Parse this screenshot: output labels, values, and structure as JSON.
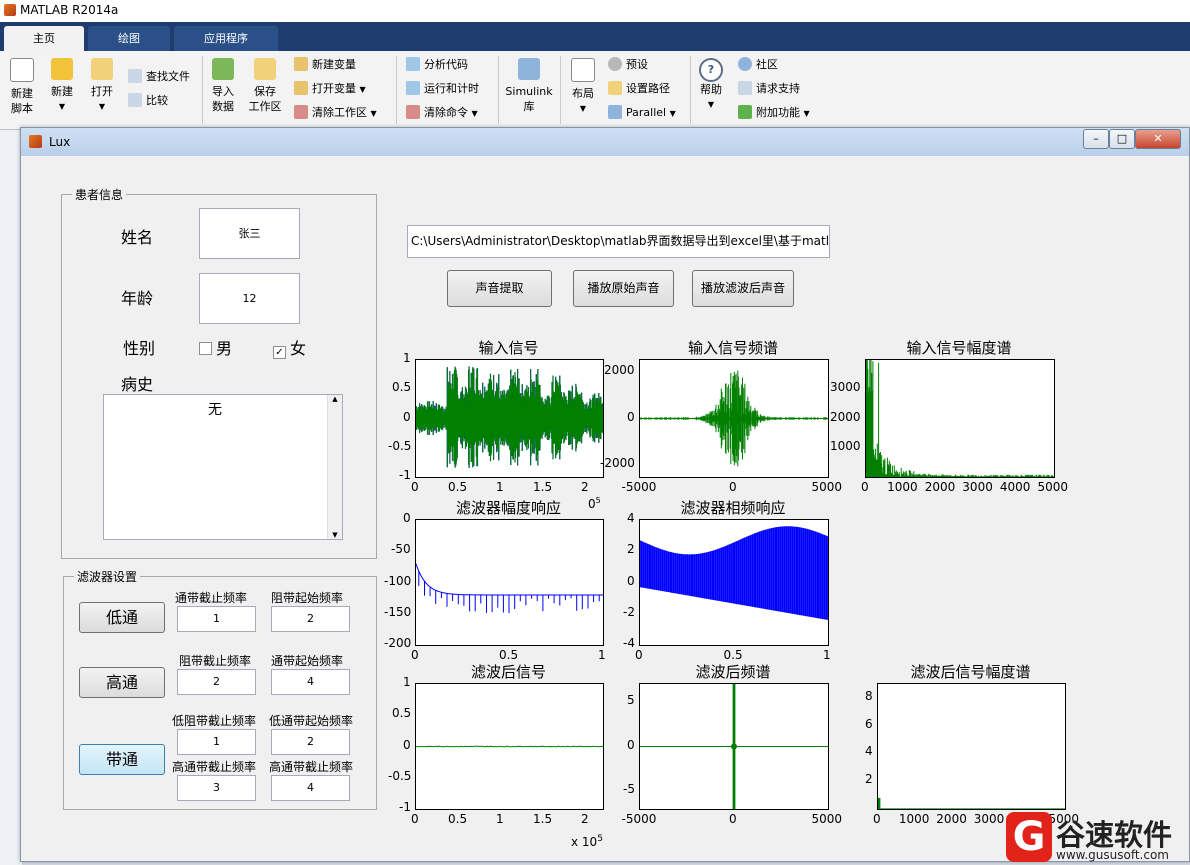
{
  "matlab": {
    "title": "MATLAB R2014a",
    "tabs": [
      "主页",
      "绘图",
      "应用程序"
    ],
    "toolbar": {
      "new_script": "新建\n脚本",
      "new": "新建",
      "open": "打开",
      "find_files": "查找文件",
      "compare": "比较",
      "import_data": "导入\n数据",
      "save_workspace": "保存\n工作区",
      "new_variable": "新建变量",
      "open_variable": "打开变量",
      "clear_workspace": "清除工作区",
      "analyze_code": "分析代码",
      "run_and_time": "运行和计时",
      "clear_commands": "清除命令",
      "simulink_library": "Simulink\n库",
      "layout": "布局",
      "preferences": "预设",
      "set_path": "设置路径",
      "parallel": "Parallel",
      "help": "帮助",
      "community": "社区",
      "request_support": "请求支持",
      "add_ons": "附加功能"
    }
  },
  "lux": {
    "title": "Lux",
    "patient_panel": {
      "title": "患者信息",
      "name_label": "姓名",
      "name_value": "张三",
      "age_label": "年龄",
      "age_value": "12",
      "gender_label": "性别",
      "male": "男",
      "female": "女",
      "male_checked": false,
      "female_checked": true,
      "history_label": "病史",
      "history_value": "无"
    },
    "filter_panel": {
      "title": "滤波器设置",
      "lowpass_button": "低通",
      "highpass_button": "高通",
      "bandpass_button": "带通",
      "lp_pass_label": "通带截止频率",
      "lp_pass_value": "1",
      "lp_stop_label": "阻带起始频率",
      "lp_stop_value": "2",
      "hp_stop_label": "阻带截止频率",
      "hp_stop_value": "2",
      "hp_pass_label": "通带起始频率",
      "hp_pass_value": "4",
      "bp_low_stop_label": "低阻带截止频率",
      "bp_low_stop_value": "1",
      "bp_low_pass_label": "低通带起始频率",
      "bp_low_pass_value": "2",
      "bp_high_pass_label": "高通带截止频率",
      "bp_high_pass_value": "3",
      "bp_high_stop_label": "高通带截止频率",
      "bp_high_stop_value": "4"
    },
    "file_path": "C:\\Users\\Administrator\\Desktop\\matlab界面数据导出到excel里\\基于matl",
    "extract_button": "声音提取",
    "play_original_button": "播放原始声音",
    "play_filtered_button": "播放滤波后声音"
  },
  "watermark": {
    "brand": "谷速软件",
    "url": "www.gususoft.com"
  },
  "colors": {
    "signal_blue": "#0000ff",
    "signal_green": "#007f00"
  },
  "chart_data": [
    {
      "id": "input-signal",
      "type": "line",
      "title": "输入信号",
      "xlim": [
        0,
        220000
      ],
      "ylim": [
        -1,
        1
      ],
      "xticks": [
        "0",
        "0.5",
        "1",
        "1.5",
        "2"
      ],
      "yticks": [
        "1",
        "0.5",
        "0",
        "-0.5",
        "-1"
      ],
      "x_exponent": "5",
      "series": [
        {
          "color": "#007f00",
          "envelope": [
            0.28,
            0.3,
            0.25,
            0.9,
            0.55,
            0.95,
            0.7,
            0.8,
            0.5,
            0.85,
            0.6,
            0.9,
            0.4,
            0.75,
            0.5,
            0.6,
            0.35,
            0.45
          ]
        }
      ]
    },
    {
      "id": "input-spectrum",
      "type": "line",
      "title": "输入信号频谱",
      "xlim": [
        -5000,
        5000
      ],
      "ylim": [
        -2500,
        2500
      ],
      "xticks": [
        "-5000",
        "0",
        "5000"
      ],
      "yticks": [
        "2000",
        "0",
        "-2000"
      ],
      "series": [
        {
          "color": "#007f00",
          "peak": 2300
        }
      ]
    },
    {
      "id": "input-amplitude-spectrum",
      "type": "line",
      "title": "输入信号幅度谱",
      "xlim": [
        0,
        5000
      ],
      "ylim": [
        0,
        4000
      ],
      "xticks": [
        "0",
        "1000",
        "2000",
        "3000",
        "4000",
        "5000"
      ],
      "yticks": [
        "3000",
        "2000",
        "1000"
      ],
      "series": [
        {
          "color": "#007f00",
          "peak": 3900
        }
      ]
    },
    {
      "id": "filter-magnitude",
      "type": "line",
      "title": "滤波器幅度响应",
      "xlim": [
        0,
        1
      ],
      "ylim": [
        -200,
        0
      ],
      "xticks": [
        "0",
        "0.5",
        "1"
      ],
      "yticks": [
        "0",
        "-50",
        "-100",
        "-150",
        "-200"
      ],
      "series": [
        {
          "color": "#0000ff",
          "start": -70,
          "floor": -120
        }
      ]
    },
    {
      "id": "filter-phase",
      "type": "line",
      "title": "滤波器相频响应",
      "xlim": [
        0,
        1
      ],
      "ylim": [
        -4,
        4
      ],
      "xticks": [
        "0",
        "0.5",
        "1"
      ],
      "yticks": [
        "4",
        "2",
        "0",
        "-2",
        "-4"
      ],
      "series": [
        {
          "color": "#0000ff",
          "amplitude": 3
        }
      ]
    },
    {
      "id": "filtered-signal",
      "type": "line",
      "title": "滤波后信号",
      "xlim": [
        0,
        220000
      ],
      "ylim": [
        -1,
        1
      ],
      "xticks": [
        "0",
        "0.5",
        "1",
        "1.5",
        "2"
      ],
      "yticks": [
        "1",
        "0.5",
        "0",
        "-0.5",
        "-1"
      ],
      "x_exponent": "5",
      "series": [
        {
          "color": "#007f00",
          "amplitude": 0.01
        }
      ]
    },
    {
      "id": "filtered-spectrum",
      "type": "line",
      "title": "滤波后频谱",
      "xlim": [
        -5000,
        5000
      ],
      "ylim": [
        -7,
        7
      ],
      "xticks": [
        "-5000",
        "0",
        "5000"
      ],
      "yticks": [
        "5",
        "0",
        "-5"
      ],
      "series": [
        {
          "color": "#007f00",
          "peak": 7
        }
      ]
    },
    {
      "id": "filtered-amplitude-spectrum",
      "type": "line",
      "title": "滤波后信号幅度谱",
      "xlim": [
        0,
        5000
      ],
      "ylim": [
        0,
        9
      ],
      "xticks": [
        "0",
        "1000",
        "2000",
        "3000",
        "4000",
        "5000"
      ],
      "yticks": [
        "8",
        "6",
        "4",
        "2"
      ],
      "series": [
        {
          "color": "#007f00",
          "peak": 0.8
        }
      ]
    }
  ]
}
